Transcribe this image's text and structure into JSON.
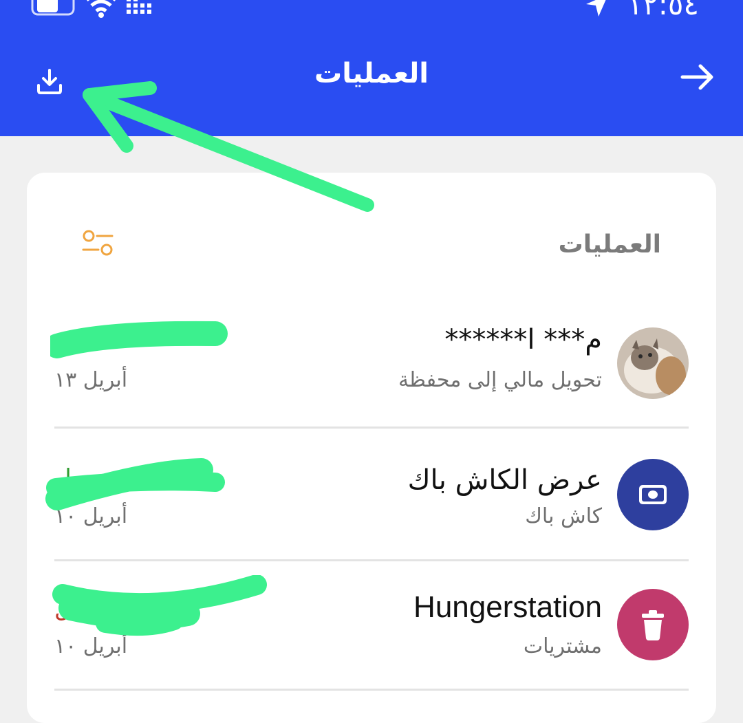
{
  "status_bar": {
    "time": "١٢:٥٤"
  },
  "header": {
    "title": "العمليات"
  },
  "card": {
    "title": "العمليات"
  },
  "transactions": [
    {
      "name": "م*** ا******",
      "subtitle": "تحويل مالي إلى محفظة",
      "date": "أبريل ١٣",
      "amount_color": "#2e9b2e"
    },
    {
      "name": "عرض الكاش باك",
      "subtitle": "كاش باك",
      "date": "أبريل ١٠",
      "amount_color": "#2e9b2e",
      "icon": "cash-icon",
      "icon_bg": "#2e3f9e"
    },
    {
      "name": "Hungerstation",
      "subtitle": "مشتريات",
      "date": "أبريل ١٠",
      "amount_color": "#c0392b",
      "icon": "trash-icon",
      "icon_bg": "#c13a6c"
    }
  ],
  "colors": {
    "header": "#2a4df2",
    "accent_filter": "#f0a540",
    "annotation": "#3cf08e"
  },
  "icons": {
    "back": "arrow-right-icon",
    "download": "download-icon",
    "filter": "filter-icon"
  }
}
